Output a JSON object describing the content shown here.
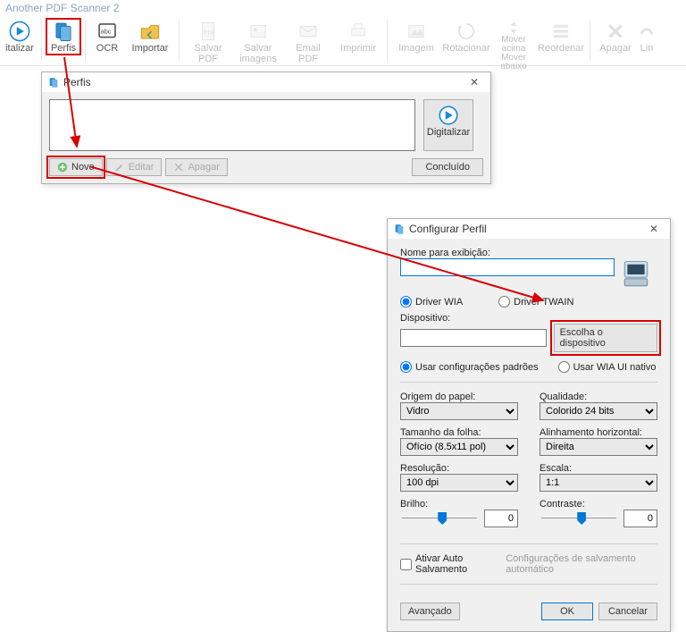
{
  "app": {
    "title": "Another PDF Scanner 2"
  },
  "ribbon": {
    "digitalizar": "italizar",
    "perfis": "Perfis",
    "ocr": "OCR",
    "importar": "Importar",
    "salvar_pdf": "Salvar PDF",
    "salvar_imagens": "Salvar imagens",
    "email_pdf": "Email PDF",
    "imprimir": "Imprimir",
    "imagem": "Imagem",
    "rotacionar": "Rotacionar",
    "mover_acima": "Mover acima",
    "mover_abaixo": "Mover abaixo",
    "reordenar": "Reordenar",
    "apagar": "Apagar",
    "lin": "Lin"
  },
  "perfis_dialog": {
    "title": "Perfis",
    "digitalizar": "Digitalizar",
    "novo": "Novo",
    "editar": "Editar",
    "apagar": "Apagar",
    "concluido": "Concluído"
  },
  "config_dialog": {
    "title": "Configurar Perfil",
    "nome_label": "Nome para exibição:",
    "nome_value": "",
    "driver_wia": "Driver WIA",
    "driver_twain": "Driver TWAIN",
    "dispositivo_label": "Dispositivo:",
    "dispositivo_value": "",
    "escolha_btn": "Escolha o dispositivo",
    "usar_padroes": "Usar configurações padrões",
    "usar_wia_nativo": "Usar WIA UI nativo",
    "origem_papel_label": "Origem do papel:",
    "origem_papel_value": "Vidro",
    "qualidade_label": "Qualidade:",
    "qualidade_value": "Colorido 24 bits",
    "tamanho_folha_label": "Tamanho da folha:",
    "tamanho_folha_value": "Ofício (8.5x11 pol)",
    "alinhamento_label": "Alinhamento horizontal:",
    "alinhamento_value": "Direita",
    "resolucao_label": "Resolução:",
    "resolucao_value": "100 dpi",
    "escala_label": "Escala:",
    "escala_value": "1:1",
    "brilho_label": "Brilho:",
    "brilho_value": "0",
    "contraste_label": "Contraste:",
    "contraste_value": "0",
    "auto_salvamento": "Ativar Auto Salvamento",
    "auto_salvamento_config": "Configurações de salvamento automático",
    "avancado": "Avançado",
    "ok": "OK",
    "cancelar": "Cancelar"
  }
}
